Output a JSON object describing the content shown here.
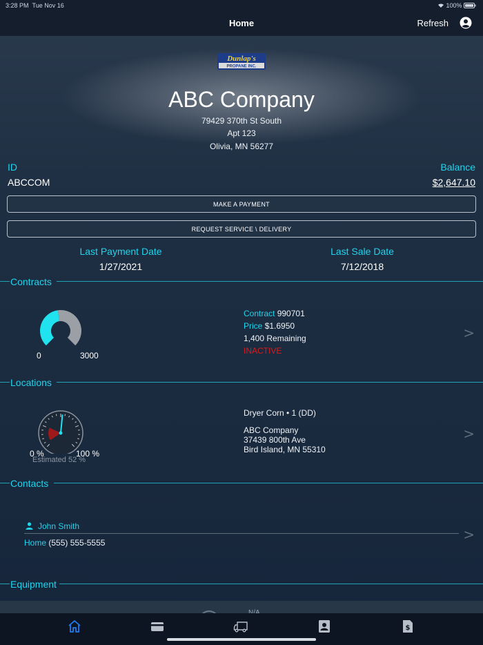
{
  "status_bar": {
    "time": "3:28 PM",
    "date": "Tue Nov 16",
    "battery": "100%"
  },
  "nav": {
    "title": "Home",
    "refresh_label": "Refresh"
  },
  "company": {
    "name": "ABC Company",
    "address_line1": "79429 370th St South",
    "address_line2": "Apt 123",
    "address_line3": "Olivia, MN 56277"
  },
  "account": {
    "id_label": "ID",
    "id_value": "ABCCOM",
    "balance_label": "Balance",
    "balance_value": "$2,647.10"
  },
  "actions": {
    "make_payment": "MAKE A PAYMENT",
    "request_service": "REQUEST SERVICE \\ DELIVERY"
  },
  "dates": {
    "last_payment_label": "Last Payment Date",
    "last_payment_value": "1/27/2021",
    "last_sale_label": "Last Sale Date",
    "last_sale_value": "7/12/2018"
  },
  "contracts": {
    "title": "Contracts",
    "gauge_min": "0",
    "gauge_max": "3000",
    "gauge_fill_fraction": 0.47,
    "contract_label": "Contract",
    "contract_value": "990701",
    "price_label": "Price",
    "price_value": "$1.6950",
    "remaining": "1,400 Remaining",
    "status": "INACTIVE"
  },
  "locations": {
    "title": "Locations",
    "tank_name": "Dryer Corn • 1 (DD)",
    "location_name": "ABC Company",
    "location_street": "37439 800th Ave",
    "location_city": "Bird Island, MN  55310",
    "gauge_min": "0 %",
    "gauge_max": "100 %",
    "estimated": "Estimated 52 %",
    "estimated_percent": 52
  },
  "contacts": {
    "title": "Contacts",
    "name": "John Smith",
    "phone_label": "Home",
    "phone_value": "(555) 555-5555"
  },
  "equipment": {
    "title": "Equipment",
    "partial_text": "N/A"
  },
  "chevron": ">",
  "colors": {
    "accent": "#21d3ec",
    "inactive": "#e01818",
    "gauge_fill": "#21e3f0",
    "gauge_empty": "#9aa0a6",
    "tab_active": "#1e7cf2"
  },
  "tabs": [
    {
      "name": "home-icon",
      "active": true
    },
    {
      "name": "credit-card-icon",
      "active": false
    },
    {
      "name": "delivery-truck-icon",
      "active": false
    },
    {
      "name": "contacts-book-icon",
      "active": false
    },
    {
      "name": "invoice-dollar-icon",
      "active": false
    }
  ]
}
